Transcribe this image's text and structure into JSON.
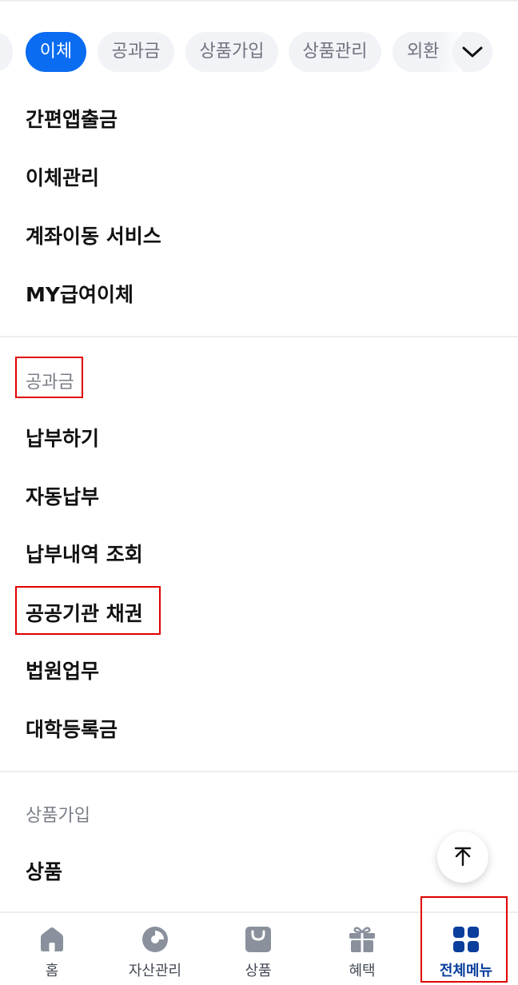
{
  "tabs": {
    "items": [
      "이체",
      "공과금",
      "상품가입",
      "상품관리",
      "외환"
    ],
    "active_index": 0,
    "more_icon": "chevron-down-icon"
  },
  "transfer": {
    "items": [
      "간편앱출금",
      "이체관리",
      "계좌이동 서비스",
      "MY급여이체"
    ]
  },
  "utility": {
    "title": "공과금",
    "items": [
      "납부하기",
      "자동납부",
      "납부내역 조회",
      "공공기관 채권",
      "법원업무",
      "대학등록금"
    ]
  },
  "product_signup": {
    "title": "상품가입",
    "items": [
      "상품"
    ]
  },
  "scroll_top_icon": "arrow-up-icon",
  "bottom_nav": {
    "items": [
      {
        "label": "홈",
        "icon": "home-icon"
      },
      {
        "label": "자산관리",
        "icon": "pie-chart-icon"
      },
      {
        "label": "상품",
        "icon": "shopping-bag-icon"
      },
      {
        "label": "혜택",
        "icon": "gift-icon"
      },
      {
        "label": "전체메뉴",
        "icon": "grid-menu-icon"
      }
    ],
    "active_index": 4
  },
  "colors": {
    "accent": "#0a6cf0",
    "active_nav": "#0a3e9c",
    "highlight": "#e10000",
    "icon_gray": "#8a919c"
  }
}
